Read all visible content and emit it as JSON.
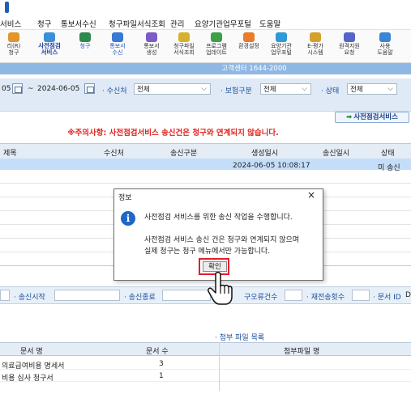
{
  "menu": [
    "서비스",
    "청구",
    "통보서수신",
    "청구파일서식조회",
    "관리",
    "요양기관업무포털",
    "도움말"
  ],
  "toolbar": [
    {
      "label": "리(R)\n청구",
      "icon": "health-icon",
      "color": "#e0962c",
      "style": "n"
    },
    {
      "label": "사전점검\n서비스",
      "icon": "check-service-icon",
      "color": "#3a8fd8",
      "style": "b"
    },
    {
      "label": "청구",
      "icon": "claim-icon",
      "color": "#2d8a4e",
      "style": "blue"
    },
    {
      "label": "통보서\n수신",
      "icon": "receive-icon",
      "color": "#3a78d6",
      "style": "blue"
    },
    {
      "label": "통보서\n생성",
      "icon": "create-icon",
      "color": "#7b5cc7",
      "style": "n"
    },
    {
      "label": "청구파일\n서식조회",
      "icon": "file-search-icon",
      "color": "#d7b12e",
      "style": "n"
    },
    {
      "label": "프로그램\n업데이트",
      "icon": "update-icon",
      "color": "#3da047",
      "style": "n"
    },
    {
      "label": "환경설정",
      "icon": "settings-icon",
      "color": "#e97b2a",
      "style": "n"
    },
    {
      "label": "요양기관\n업무포털",
      "icon": "portal-icon",
      "color": "#2f9ad4",
      "style": "n"
    },
    {
      "label": "E-평가\n시스템",
      "icon": "evaluation-icon",
      "color": "#d4a22a",
      "style": "n"
    },
    {
      "label": "원격지원\n요청",
      "icon": "remote-support-icon",
      "color": "#5565c7",
      "style": "n"
    },
    {
      "label": "사용\n도움말",
      "icon": "help-icon",
      "color": "#3a86d2",
      "style": "n"
    }
  ],
  "callcenter": "고객센터 1644-2000",
  "filter": {
    "date_from_tail": "05",
    "date_sep": "~",
    "date_to": "2024-06-05",
    "recipient_label": "· 수신처",
    "recipient_value": "전체",
    "insurance_label": "· 보험구분",
    "insurance_value": "전체",
    "status_label": "· 상태",
    "status_value": "전체"
  },
  "service_button": "사전점검서비스",
  "notice": "※주의사항: 사전점검서비스 송신건은 청구와 연계되지 않습니다.",
  "grid": {
    "headers": [
      "제목",
      "수신처",
      "송신구분",
      "생성일시",
      "송신일시",
      "상태"
    ],
    "row": {
      "created": "2024-06-05 10:08:17",
      "status": "미 송신"
    }
  },
  "info_row": {
    "send_start": "· 송신시작",
    "send_end": "· 송신종료",
    "error_count": "구오류건수",
    "resend_count": "· 재전송횟수",
    "doc_id": "· 문서 ID",
    "doc_id_tail": "D"
  },
  "bottom": {
    "headers": [
      "문서 명",
      "문서 수",
      "첨부파일 명"
    ],
    "attach_title": "· 첨부 파일 목록",
    "rows": [
      {
        "name": "의료급여비용 명세서",
        "count": "3"
      },
      {
        "name": "비용 심사 청구서",
        "count": "1"
      }
    ]
  },
  "dialog": {
    "title": "정보",
    "close": "×",
    "message_1": "사전점검 서비스를 위한 송신 작업을 수행합니다.",
    "message_2": "사전점검 서비스 송신 건은 청구와 연계되지 않으며",
    "message_3": "실제 청구는 청구 메뉴에서만 가능합니다.",
    "ok": "확인"
  },
  "colors": {
    "accent": "#1c4f9c",
    "notice": "#e0221c",
    "highlight": "#e0202a",
    "selected_row": "#c4defa"
  }
}
